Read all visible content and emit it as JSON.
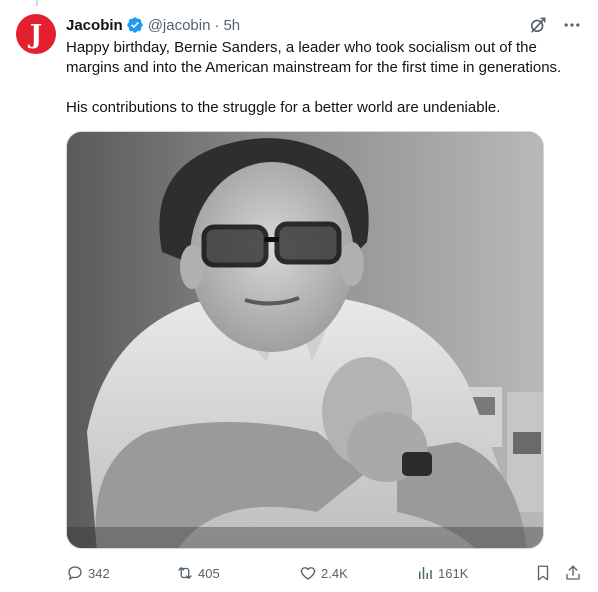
{
  "tweet": {
    "author_name": "Jacobin",
    "avatar_letter": "J",
    "handle": "@jacobin",
    "separator": "·",
    "time": "5h",
    "paragraphs": [
      "Happy birthday, Bernie Sanders, a leader who took socialism out of the margins and into the American mainstream for the first time in generations.",
      "His contributions to the struggle for a better world are undeniable."
    ],
    "brand_color": "#e4202f",
    "verified_color": "#1d9bf0"
  },
  "metrics": {
    "replies": "342",
    "reposts": "405",
    "likes": "2.4K",
    "views": "161K"
  }
}
